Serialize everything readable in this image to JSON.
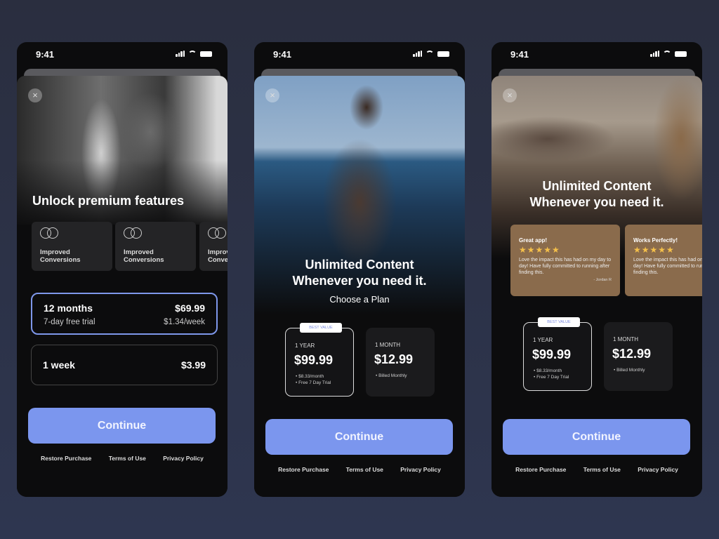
{
  "status": {
    "time": "9:41"
  },
  "colors": {
    "accent": "#7b96ee",
    "review_card": "#8a6b4c",
    "star": "#f5c04a"
  },
  "footer_links": [
    "Restore Purchase",
    "Terms of Use",
    "Privacy Policy"
  ],
  "continue_label": "Continue",
  "close_icon": "×",
  "screen1": {
    "title": "Unlock premium features",
    "features": [
      {
        "label": "Improved\nConversions"
      },
      {
        "label": "Improved\nConversions"
      },
      {
        "label": "Improved\nConversions"
      }
    ],
    "plans": [
      {
        "name": "12 months",
        "price": "$69.99",
        "subtitle": "7-day free trial",
        "per_week": "$1.34/week",
        "selected": true
      },
      {
        "name": "1 week",
        "price": "$3.99",
        "selected": false
      }
    ]
  },
  "screen2": {
    "title_line1": "Unlimited Content",
    "title_line2": "Whenever you need it.",
    "subtitle": "Choose a Plan",
    "cards": [
      {
        "badge": "BEST VALUE",
        "period": "1 YEAR",
        "price": "$99.99",
        "bullets": [
          "$8.33/month",
          "Free 7 Day Trial"
        ],
        "selected": true
      },
      {
        "period": "1 MONTH",
        "price": "$12.99",
        "bullets": [
          "Billed Monthly"
        ],
        "selected": false
      }
    ]
  },
  "screen3": {
    "title_line1": "Unlimited Content",
    "title_line2": "Whenever you need it.",
    "reviews": [
      {
        "title": "Great app!",
        "stars": "★★★★★",
        "body": "Love the impact this has had on my day to day! Have fully committed to running after finding this.",
        "author": "- Jordan R"
      },
      {
        "title": "Works Perfectly!",
        "stars": "★★★★★",
        "body": "Love the impact this has had on my day to day! Have fully committed to running after finding this.",
        "author": ""
      }
    ],
    "cards": [
      {
        "badge": "BEST VALUE",
        "period": "1 YEAR",
        "price": "$99.99",
        "bullets": [
          "$8.33/month",
          "Free 7 Day Trial"
        ],
        "selected": true
      },
      {
        "period": "1 MONTH",
        "price": "$12.99",
        "bullets": [
          "Billed Monthly"
        ],
        "selected": false
      }
    ]
  }
}
